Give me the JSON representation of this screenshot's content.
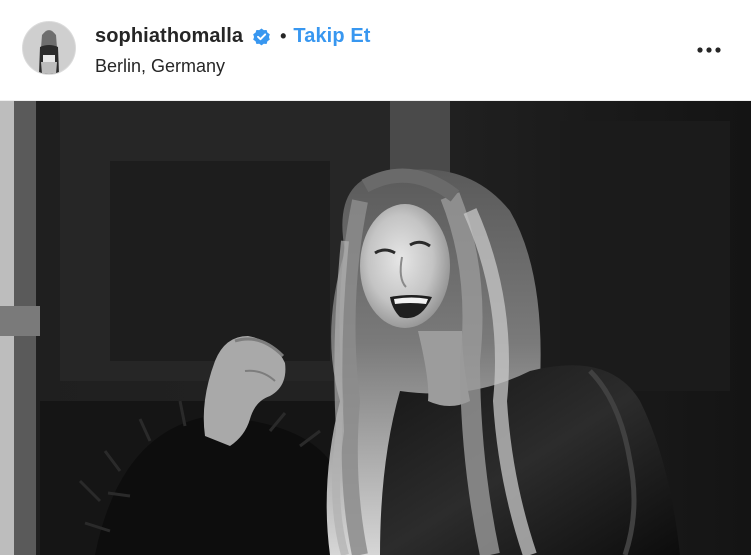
{
  "post": {
    "header": {
      "avatar_icon": "profile-photo",
      "username": "sophiathomalla",
      "verified_icon": "verified-badge-icon",
      "verified_color": "#3897f0",
      "separator": "•",
      "follow_label": "Takip Et",
      "follow_color": "#3897f0",
      "location": "Berlin, Germany",
      "more_icon": "more-options-icon"
    },
    "media": {
      "type": "photo",
      "style": "black-and-white"
    }
  }
}
